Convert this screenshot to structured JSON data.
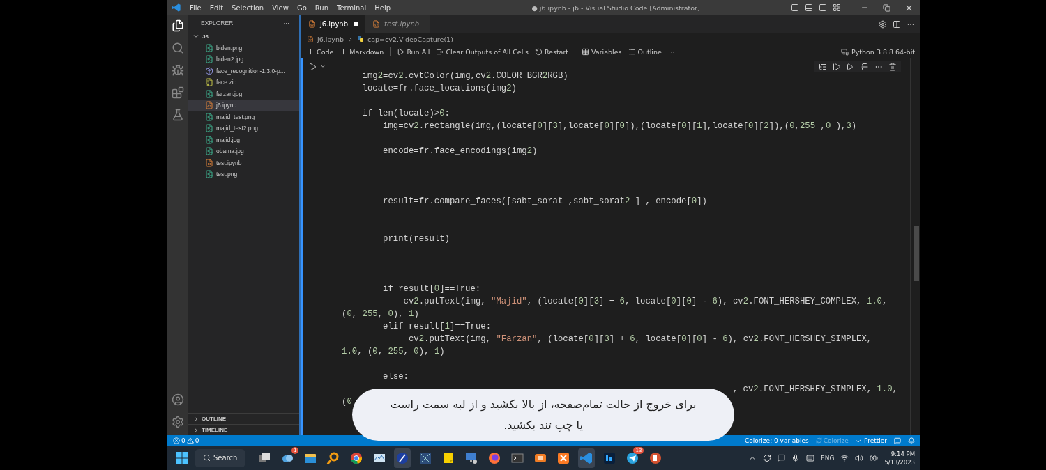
{
  "window": {
    "title": "● j6.ipynb - j6 - Visual Studio Code [Administrator]"
  },
  "menu": [
    "File",
    "Edit",
    "Selection",
    "View",
    "Go",
    "Run",
    "Terminal",
    "Help"
  ],
  "sidebar": {
    "title": "EXPLORER",
    "more": "···",
    "folder": {
      "name": "J6",
      "expanded": true,
      "files": [
        {
          "name": "biden.png",
          "kind": "image",
          "selected": false
        },
        {
          "name": "biden2.jpg",
          "kind": "image",
          "selected": false
        },
        {
          "name": "face_recognition-1.3.0-p...",
          "kind": "package",
          "selected": false
        },
        {
          "name": "face.zip",
          "kind": "archive",
          "selected": false
        },
        {
          "name": "farzan.jpg",
          "kind": "image",
          "selected": false
        },
        {
          "name": "j6.ipynb",
          "kind": "notebook",
          "selected": true
        },
        {
          "name": "majid_test.png",
          "kind": "image",
          "selected": false
        },
        {
          "name": "majid_test2.png",
          "kind": "image",
          "selected": false
        },
        {
          "name": "majid.jpg",
          "kind": "image",
          "selected": false
        },
        {
          "name": "obama.jpg",
          "kind": "image",
          "selected": false
        },
        {
          "name": "test.ipynb",
          "kind": "notebook",
          "selected": false
        },
        {
          "name": "test.png",
          "kind": "image",
          "selected": false
        }
      ]
    },
    "sections": [
      {
        "name": "OUTLINE",
        "expanded": false
      },
      {
        "name": "TIMELINE",
        "expanded": false
      }
    ]
  },
  "tabs": [
    {
      "label": "j6.ipynb",
      "selected": true,
      "modified": true,
      "preview": false
    },
    {
      "label": "test.ipynb",
      "selected": false,
      "modified": false,
      "preview": true
    }
  ],
  "breadcrumb": [
    "j6.ipynb",
    "cap=cv2.VideoCapture(1)"
  ],
  "notebook_toolbar": [
    {
      "label": "Code",
      "kind": "add"
    },
    {
      "label": "Markdown",
      "kind": "add"
    },
    {
      "label": "Run All",
      "kind": "run"
    },
    {
      "label": "Clear Outputs of All Cells",
      "kind": "clear"
    },
    {
      "label": "Restart",
      "kind": "restart"
    },
    {
      "label": "Variables",
      "kind": "variables"
    },
    {
      "label": "Outline",
      "kind": "outline"
    }
  ],
  "toolbar_more": "···",
  "kernel": "Python 3.8.8 64-bit",
  "cell": {
    "focused": true,
    "lines": [
      {
        "kind": "code",
        "text": "    img2=cv2.cvtColor(img,cv2.COLOR_BGR2RGB)",
        "cursor": false
      },
      {
        "kind": "code",
        "text": "    locate=fr.face_locations(img2)",
        "cursor": false
      },
      {
        "kind": "blank"
      },
      {
        "kind": "code",
        "text": "    if len(locate)>0: ",
        "cursor": true
      },
      {
        "kind": "code",
        "text": "        img=cv2.rectangle(img,(locate[0][3],locate[0][0]),(locate[0][1],locate[0][2]),(0,255 ,0 ),3)",
        "cursor": false
      },
      {
        "kind": "blank"
      },
      {
        "kind": "code",
        "text": "        encode=fr.face_encodings(img2)",
        "cursor": false
      },
      {
        "kind": "blank"
      },
      {
        "kind": "blank"
      },
      {
        "kind": "blank"
      },
      {
        "kind": "code",
        "text": "        result=fr.compare_faces([sabt_sorat ,sabt_sorat2 ] , encode[0])",
        "cursor": false
      },
      {
        "kind": "blank"
      },
      {
        "kind": "blank"
      },
      {
        "kind": "code",
        "text": "        print(result)",
        "cursor": false
      },
      {
        "kind": "blank"
      },
      {
        "kind": "blank"
      },
      {
        "kind": "blank"
      },
      {
        "kind": "code",
        "text": "        if result[0]==True:",
        "cursor": false
      },
      {
        "kind": "code",
        "text": "            cv2.putText(img, \"Majid\", (locate[0][3] + 6, locate[0][0] - 6), cv2.FONT_HERSHEY_COMPLEX, 1.0,",
        "cursor": false
      },
      {
        "kind": "code",
        "text": "(0, 255, 0), 1)",
        "cursor": false
      },
      {
        "kind": "code",
        "text": "        elif result[1]==True:",
        "cursor": false
      },
      {
        "kind": "code",
        "text": "             cv2.putText(img, \"Farzan\", (locate[0][3] + 6, locate[0][0] - 6), cv2.FONT_HERSHEY_SIMPLEX,",
        "cursor": false
      },
      {
        "kind": "code",
        "text": "1.0, (0, 255, 0), 1)",
        "cursor": false
      },
      {
        "kind": "blank"
      },
      {
        "kind": "code",
        "text": "        else:",
        "cursor": false
      },
      {
        "kind": "code",
        "text": "                                                                            , cv2.FONT_HERSHEY_SIMPLEX, 1.0,",
        "cursor": false
      },
      {
        "kind": "code",
        "text": "(0",
        "cursor": false
      }
    ]
  },
  "notification": {
    "text": "برای خروج از حالت تمام‌صفحه، از بالا بکشید و از لبه سمت راست یا چپ تند بکشید."
  },
  "status_bar": {
    "errors": "0",
    "warnings": "0",
    "right": [
      {
        "text": "Colorize: 0 variables",
        "disabled": false,
        "kind": "text"
      },
      {
        "text": "Colorize",
        "disabled": true,
        "kind": "colorize"
      },
      {
        "text": "Prettier",
        "disabled": false,
        "kind": "prettier"
      }
    ]
  },
  "taskbar": {
    "search": "Search",
    "apps": [
      {
        "kind": "taskview",
        "active": false
      },
      {
        "kind": "cloud",
        "badge": "1",
        "active": false
      },
      {
        "kind": "folder",
        "active": false
      },
      {
        "kind": "magnifier",
        "active": false
      },
      {
        "kind": "chrome",
        "active": false
      },
      {
        "kind": "chart",
        "active": false
      },
      {
        "kind": "feather",
        "active": true
      },
      {
        "kind": "network",
        "active": false
      },
      {
        "kind": "note",
        "active": false
      },
      {
        "kind": "monitor",
        "active": false
      },
      {
        "kind": "fox",
        "active": false
      },
      {
        "kind": "terminal",
        "active": false
      },
      {
        "kind": "camera",
        "active": false
      },
      {
        "kind": "xampp",
        "active": false
      },
      {
        "kind": "code",
        "active": true
      },
      {
        "kind": "ps",
        "active": false
      },
      {
        "kind": "telegram",
        "badge": "13",
        "active": false
      },
      {
        "kind": "slides",
        "active": false
      }
    ],
    "language": "ENG",
    "time": "9:14 PM",
    "date": "5/13/2023"
  }
}
